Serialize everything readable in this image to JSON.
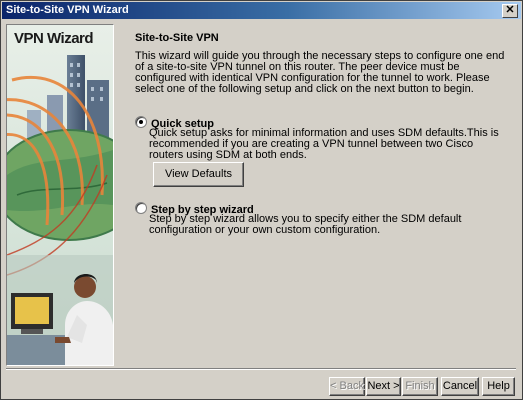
{
  "window": {
    "title": "Site-to-Site VPN Wizard",
    "close_label": "✕"
  },
  "side_panel": {
    "title": "VPN Wizard"
  },
  "content": {
    "heading": "Site-to-Site VPN",
    "intro": "This wizard will guide you through the necessary steps to configure one end of a site-to-site VPN tunnel on this router. The peer device must be configured with identical VPN configuration for the tunnel to work. Please select one of the following setup and click on the next button to begin.",
    "options": [
      {
        "label": "Quick setup",
        "selected": true,
        "description": "Quick setup asks for minimal information and uses SDM defaults.This is recommended if you are creating a VPN tunnel between two Cisco routers using SDM at both ends."
      },
      {
        "label": "Step by step wizard",
        "selected": false,
        "description": "Step by step wizard allows you to specify either the SDM default configuration or your own custom configuration."
      }
    ],
    "view_defaults_label": "View Defaults"
  },
  "footer": {
    "back_label": "< Back",
    "next_label": "Next >",
    "finish_label": "Finish",
    "cancel_label": "Cancel",
    "help_label": "Help"
  }
}
